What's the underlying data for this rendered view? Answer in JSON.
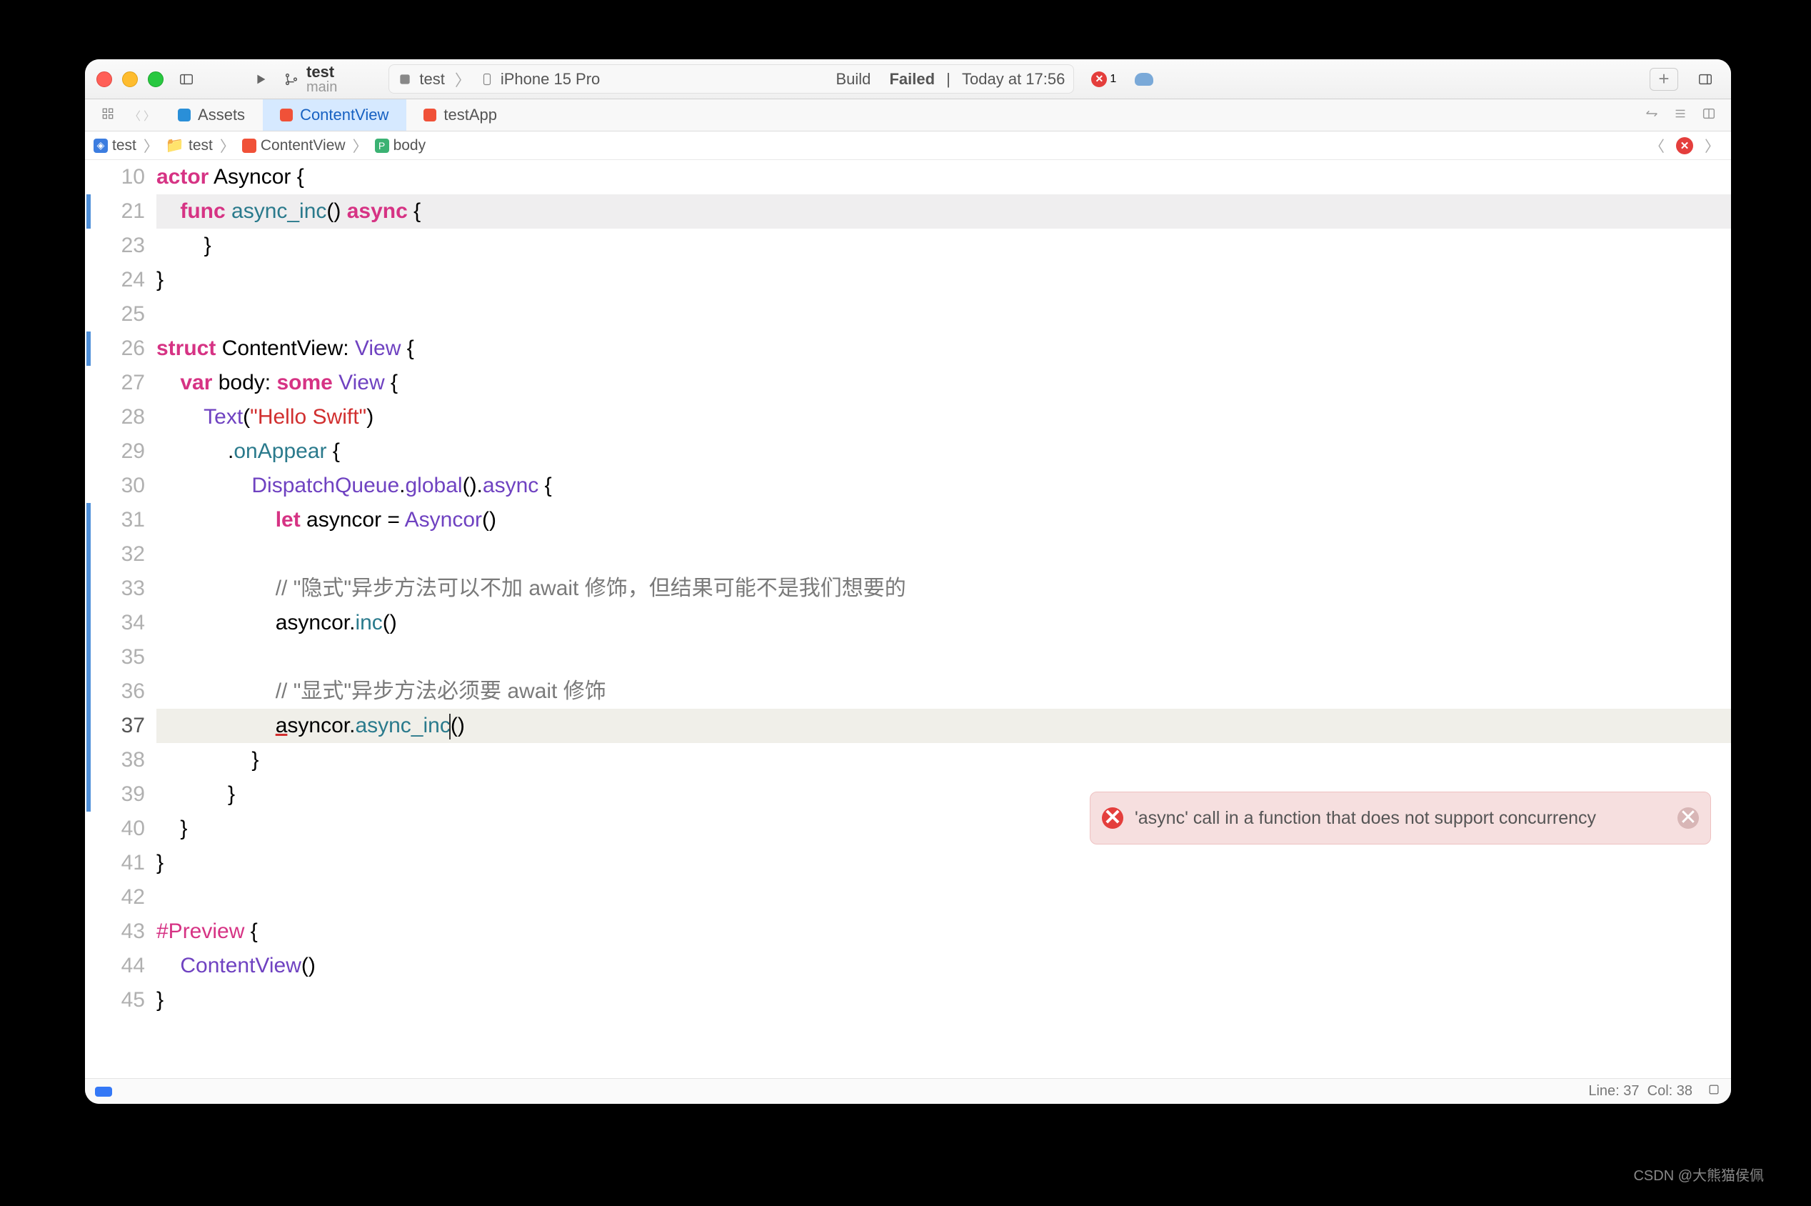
{
  "titlebar": {
    "scheme_name": "test",
    "scheme_branch": "main",
    "status_target": "test",
    "status_device": "iPhone 15 Pro",
    "build_label": "Build",
    "build_result": "Failed",
    "build_time": "Today at 17:56",
    "error_count": "1"
  },
  "tabs": {
    "assets": "Assets",
    "content_view": "ContentView",
    "test_app": "testApp"
  },
  "breadcrumb": {
    "project": "test",
    "folder": "test",
    "file": "ContentView",
    "symbol": "body"
  },
  "gutter": {
    "start": 10,
    "highlight_21": "21",
    "lines": [
      "10",
      "21",
      "23",
      "24",
      "25",
      "26",
      "27",
      "28",
      "29",
      "30",
      "31",
      "32",
      "33",
      "34",
      "35",
      "36",
      "37",
      "38",
      "39",
      "40",
      "41",
      "42",
      "43",
      "44",
      "45"
    ]
  },
  "code": {
    "l10_kw1": "actor",
    "l10_id": " Asyncor {",
    "l21_kw1": "func",
    "l21_fn": " async_inc",
    "l21_rest": "() ",
    "l21_kw2": "async",
    "l21_brace": " {",
    "l23": "        }",
    "l24": "}",
    "l25": "",
    "l26_kw": "struct",
    "l26_id": " ContentView: ",
    "l26_type": "View",
    "l26_br": " {",
    "l27_kw": "var",
    "l27_id": " body: ",
    "l27_kw2": "some",
    "l27_sp": " ",
    "l27_type": "View",
    "l27_br": " {",
    "l28_type": "Text",
    "l28_p": "(",
    "l28_str": "\"Hello Swift\"",
    "l28_cp": ")",
    "l29_dot": ".",
    "l29_fn": "onAppear",
    "l29_br": " {",
    "l30_type": "DispatchQueue",
    "l30_d1": ".",
    "l30_fn1": "global",
    "l30_p": "().",
    "l30_fn2": "async",
    "l30_br": " {",
    "l31_kw": "let",
    "l31_rest": " asyncor = ",
    "l31_type": "Asyncor",
    "l31_p": "()",
    "l32": "",
    "l33_cm": "// \"隐式\"异步方法可以不加 await 修饰，但结果可能不是我们想要的",
    "l34_id": "asyncor.",
    "l34_fn": "inc",
    "l34_p": "()",
    "l35": "",
    "l36_cm": "// \"显式\"异步方法必须要 await 修饰",
    "l37_a": "a",
    "l37_rest": "syncor.",
    "l37_fn": "async_inc",
    "l37_p": "()",
    "l38": "                }",
    "l39": "            }",
    "l40": "    }",
    "l41": "}",
    "l42": "",
    "l43_pp": "#Preview",
    "l43_br": " {",
    "l44_type": "ContentView",
    "l44_p": "()",
    "l45": "}"
  },
  "error": {
    "message": "'async' call in a function that does not support concurrency"
  },
  "footer": {
    "line": "Line: 37",
    "col": "Col: 38"
  },
  "watermark": "CSDN @大熊猫侯佩"
}
